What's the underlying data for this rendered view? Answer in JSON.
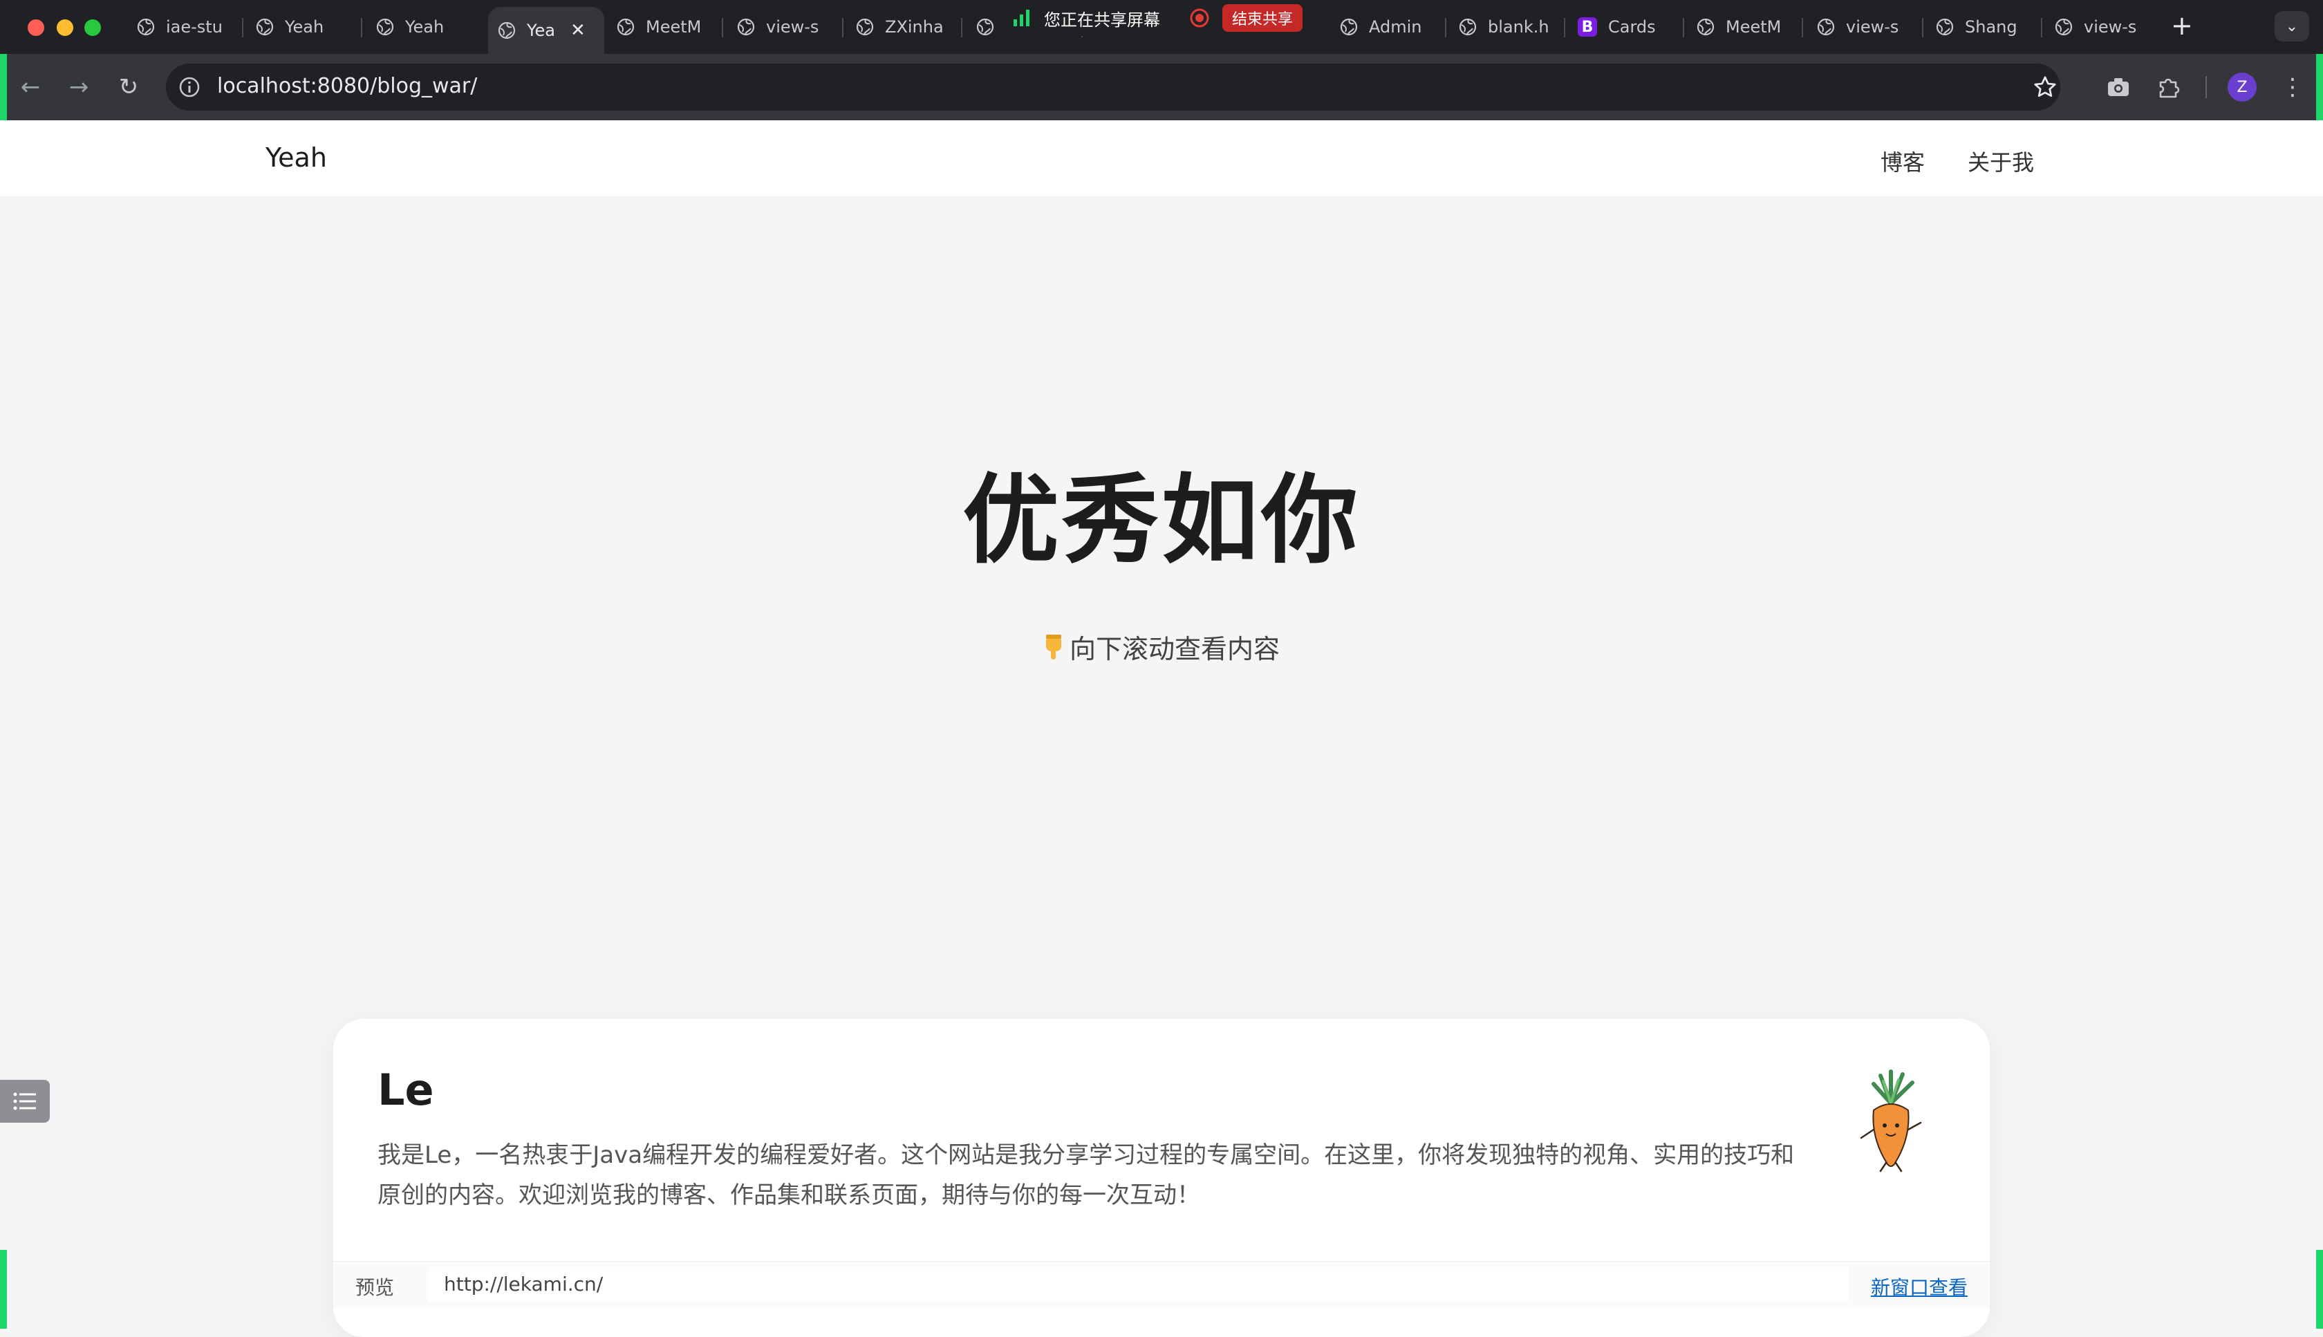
{
  "browser": {
    "tabs": [
      {
        "title": "iae-stu",
        "favicon": "globe-icon"
      },
      {
        "title": "Yeah",
        "favicon": "globe-icon"
      },
      {
        "title": "Yeah",
        "favicon": "globe-icon"
      },
      {
        "title": "Yea",
        "favicon": "globe-icon",
        "active": true
      },
      {
        "title": "MeetM",
        "favicon": "globe-icon"
      },
      {
        "title": "view-s",
        "favicon": "globe-icon"
      },
      {
        "title": "ZXinha",
        "favicon": "globe-icon"
      },
      {
        "title": "",
        "favicon": "globe-icon"
      },
      {
        "title": "Admin",
        "favicon": "globe-icon"
      },
      {
        "title": "blank.h",
        "favicon": "globe-icon"
      },
      {
        "title": "Cards",
        "favicon": "bootstrap-icon"
      },
      {
        "title": "MeetM",
        "favicon": "globe-icon"
      },
      {
        "title": "view-s",
        "favicon": "globe-icon"
      },
      {
        "title": "Shang",
        "favicon": "globe-icon"
      },
      {
        "title": "view-s",
        "favicon": "globe-icon"
      }
    ],
    "screen_share": {
      "status": "您正在共享屏幕",
      "stop_label": "结束共享"
    },
    "url": "localhost:8080/blog_war/",
    "profile_initial": "Z"
  },
  "site": {
    "brand": "Yeah",
    "nav": {
      "blog": "博客",
      "about": "关于我"
    }
  },
  "hero": {
    "title": "优秀如你",
    "subtitle": "向下滚动查看内容"
  },
  "card": {
    "name": "Le",
    "description": "我是Le，一名热衷于Java编程开发的编程爱好者。这个网站是我分享学习过程的专属空间。在这里，你将发现独特的视角、实用的技巧和原创的内容。欢迎浏览我的博客、作品集和联系页面，期待与你的每一次互动！",
    "preview_label": "预览",
    "preview_url": "http://lekami.cn/",
    "open_new_window": "新窗口查看"
  },
  "colors": {
    "accent_green": "#1fd66b",
    "link_blue": "#0a66c2",
    "page_bg": "#f5f5f7"
  }
}
